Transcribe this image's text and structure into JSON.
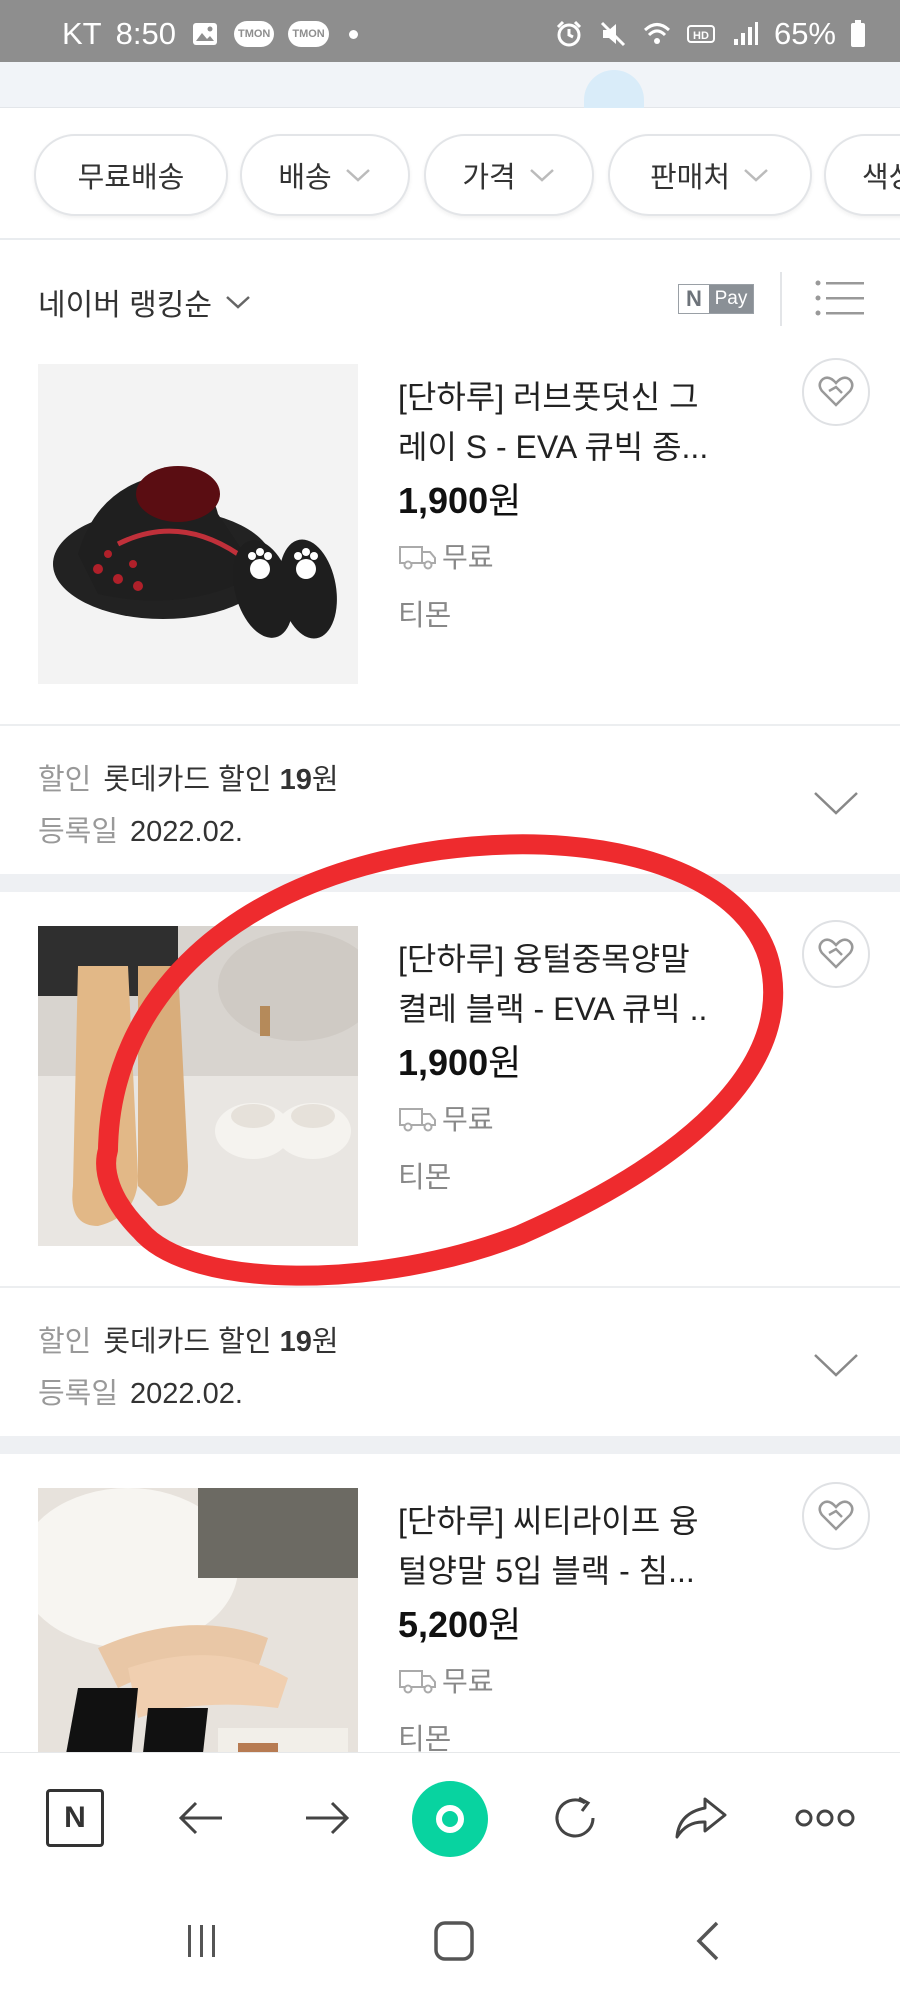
{
  "status_bar": {
    "carrier": "KT",
    "time": "8:50",
    "badge_1": "TMON",
    "badge_2": "TMON",
    "battery": "65%"
  },
  "filters": [
    {
      "label": "무료배송",
      "has_chevron": false
    },
    {
      "label": "배송",
      "has_chevron": true
    },
    {
      "label": "가격",
      "has_chevron": true
    },
    {
      "label": "판매처",
      "has_chevron": true
    },
    {
      "label": "색상",
      "has_chevron": true
    }
  ],
  "sort": {
    "label": "네이버 랭킹순",
    "npay_n": "N",
    "npay_pay": "Pay"
  },
  "products": [
    {
      "title_line1": "[단하루] 러브풋덧신 그",
      "title_line2": "레이 S - EVA 큐빅 종...",
      "price": "1,900",
      "currency": "원",
      "shipping": "무료",
      "mall": "티몬",
      "discount_label": "할인",
      "discount_text": "롯데카드 할인 ",
      "discount_amount": "19",
      "discount_unit": "원",
      "reg_label": "등록일",
      "reg_date": "2022.02."
    },
    {
      "title_line1": "[단하루] 융털중목양말",
      "title_line2": "켤레 블랙 - EVA 큐빅 ..",
      "price": "1,900",
      "currency": "원",
      "shipping": "무료",
      "mall": "티몬",
      "discount_label": "할인",
      "discount_text": "롯데카드 할인 ",
      "discount_amount": "19",
      "discount_unit": "원",
      "reg_label": "등록일",
      "reg_date": "2022.02."
    },
    {
      "title_line1": "[단하루] 씨티라이프 융",
      "title_line2": "털양말 5입 블랙 - 침...",
      "price": "5,200",
      "currency": "원",
      "shipping": "무료",
      "mall": "티몬"
    }
  ],
  "toolbar": {
    "home_letter": "N"
  },
  "colors": {
    "accent_green": "#08d3a0",
    "annotation_red": "#ee2b2e",
    "status_bar_bg": "#8e8e8e"
  }
}
